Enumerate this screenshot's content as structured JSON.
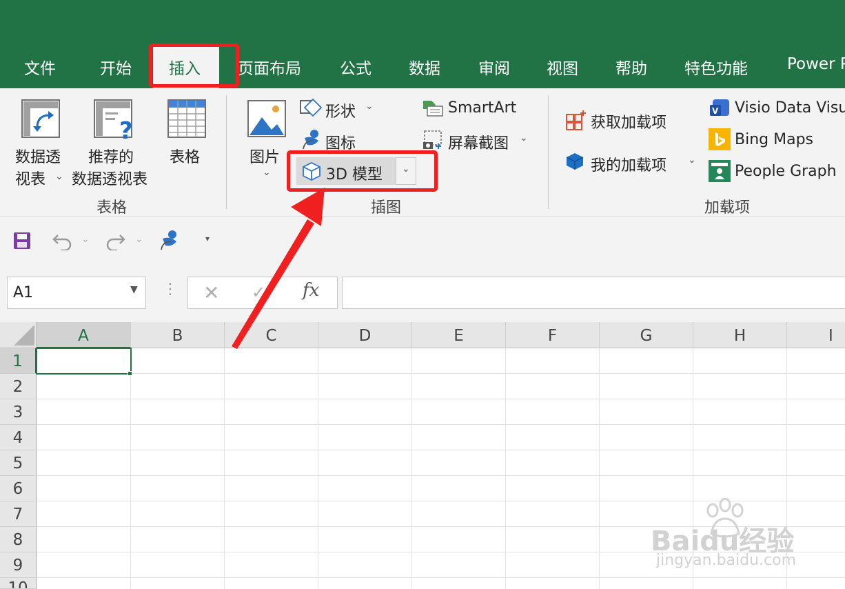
{
  "tabs": [
    "文件",
    "开始",
    "插入",
    "页面布局",
    "公式",
    "数据",
    "审阅",
    "视图",
    "帮助",
    "特色功能",
    "Power P"
  ],
  "active_tab": "插入",
  "ribbon": {
    "tables": {
      "pivot_line1": "数据透",
      "pivot_line2": "视表",
      "recommended_line1": "推荐的",
      "recommended_line2": "数据透视表",
      "table": "表格",
      "group": "表格"
    },
    "illustrations": {
      "pictures": "图片",
      "shapes": "形状",
      "icons": "图标",
      "model3d": "3D 模型",
      "smartart": "SmartArt",
      "screenshot": "屏幕截图",
      "group": "插图"
    },
    "addins": {
      "get": "获取加载项",
      "my": "我的加载项",
      "visio": "Visio Data Visu",
      "bing": "Bing Maps",
      "people": "People Graph",
      "group": "加载项"
    }
  },
  "formula_bar": {
    "name_box": "A1",
    "fx": "fx"
  },
  "columns": [
    "A",
    "B",
    "C",
    "D",
    "E",
    "F",
    "G",
    "H",
    "I"
  ],
  "rows": [
    "1",
    "2",
    "3",
    "4",
    "5",
    "6",
    "7",
    "8",
    "9",
    "10"
  ],
  "watermark": {
    "main": "Baidu经验",
    "sub": "jingyan.baidu.com"
  },
  "colors": {
    "brand": "#217346",
    "highlight": "#f02020"
  }
}
